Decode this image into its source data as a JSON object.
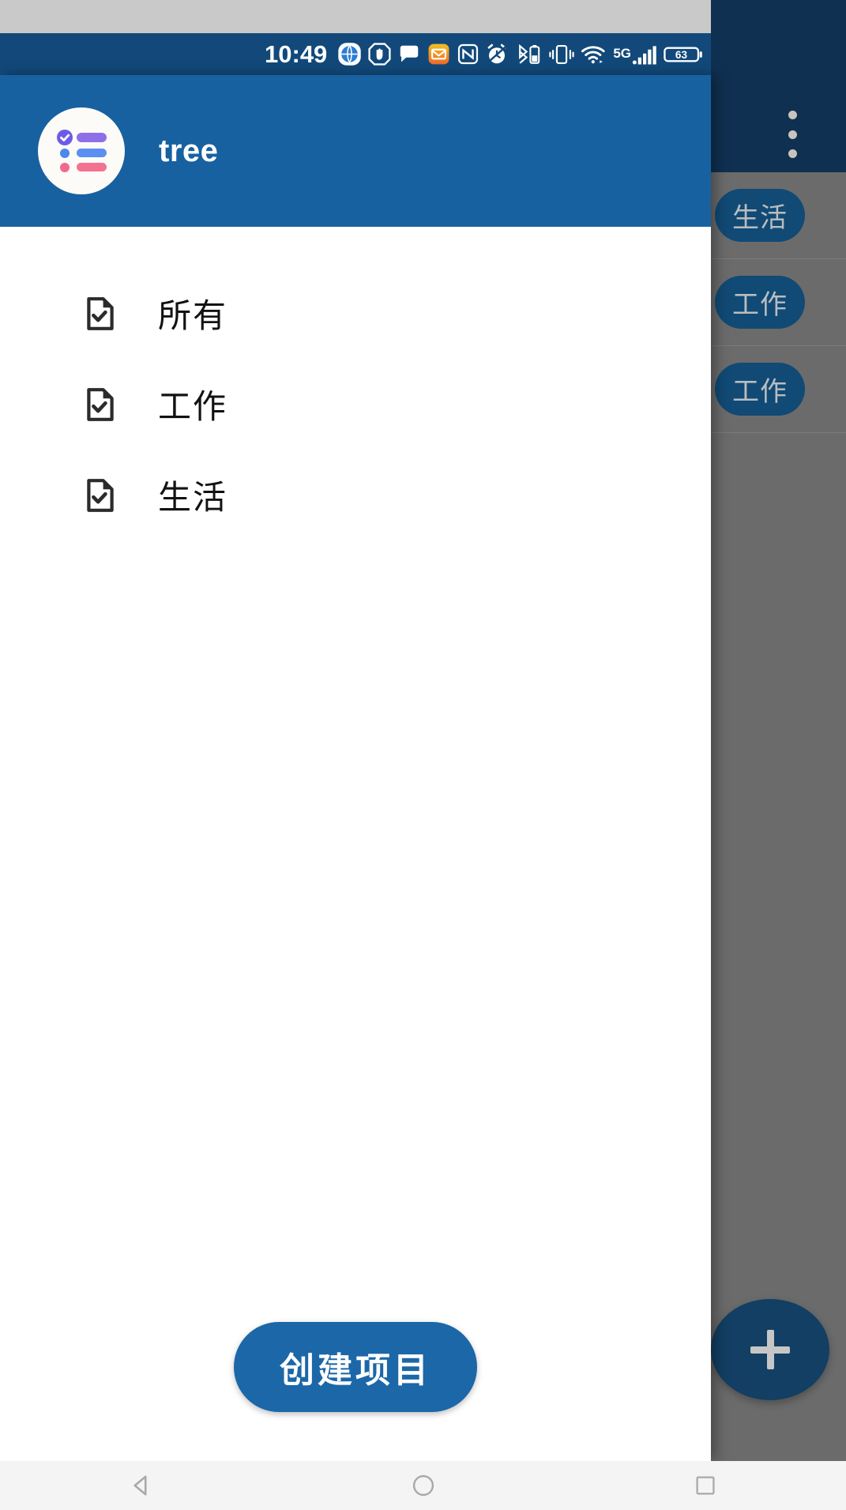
{
  "status_bar": {
    "time": "10:49",
    "battery_level": "63",
    "network_type": "5G",
    "icons": [
      "browser-globe-icon",
      "stop-hand-icon",
      "chat-bubble-icon",
      "mail-envelope-icon",
      "nfc-icon",
      "alarm-clock-icon",
      "bluetooth-battery-icon",
      "vibrate-mode-icon",
      "wifi-icon",
      "signal-bars-icon",
      "battery-icon"
    ],
    "background_color": "#12497a"
  },
  "drawer": {
    "title": "tree",
    "header_color": "#1761a0",
    "logo_name": "tree-app-checklist-logo",
    "items": [
      {
        "label": "所有",
        "icon": "document-check-icon"
      },
      {
        "label": "工作",
        "icon": "document-check-icon"
      },
      {
        "label": "生活",
        "icon": "document-check-icon"
      }
    ],
    "footer": {
      "create_label": "创建项目",
      "button_color": "#1b67a8"
    }
  },
  "background_app": {
    "appbar_color": "#0f3050",
    "overflow_menu_name": "overflow-menu-icon",
    "scrim_color": "#6b6b6b",
    "rows": [
      {
        "chip": "生活"
      },
      {
        "chip": "工作"
      },
      {
        "chip": "工作"
      }
    ],
    "fab": {
      "icon": "plus-icon",
      "color": "#123f63"
    }
  },
  "nav_bar": {
    "buttons": [
      {
        "name": "back-button",
        "icon": "triangle-back-icon"
      },
      {
        "name": "home-button",
        "icon": "circle-home-icon"
      },
      {
        "name": "recents-button",
        "icon": "square-recents-icon"
      }
    ],
    "background_color": "#f4f4f4"
  }
}
